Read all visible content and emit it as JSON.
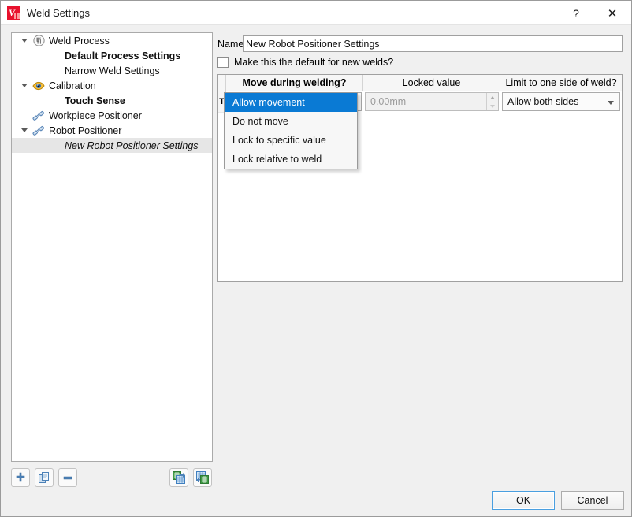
{
  "window": {
    "title": "Weld Settings",
    "app_icon": "weld-app-icon",
    "help_label": "?",
    "close_label": "✕"
  },
  "tree": {
    "items": [
      {
        "label": "Weld Process",
        "icon": "weld-process-icon",
        "indent": 0,
        "arrow": "expanded",
        "style": "normal",
        "selected": false
      },
      {
        "label": "Default Process Settings",
        "icon": "none",
        "indent": 1,
        "arrow": "none",
        "style": "bold",
        "selected": false
      },
      {
        "label": "Narrow Weld Settings",
        "icon": "none",
        "indent": 1,
        "arrow": "none",
        "style": "normal",
        "selected": false
      },
      {
        "label": "Calibration",
        "icon": "calibration-eye-icon",
        "indent": 0,
        "arrow": "expanded",
        "style": "normal",
        "selected": false
      },
      {
        "label": "Touch Sense",
        "icon": "none",
        "indent": 1,
        "arrow": "none",
        "style": "bold",
        "selected": false
      },
      {
        "label": "Workpiece Positioner",
        "icon": "positioner-icon",
        "indent": 0,
        "arrow": "none",
        "style": "normal",
        "selected": false
      },
      {
        "label": "Robot Positioner",
        "icon": "positioner-icon",
        "indent": 0,
        "arrow": "expanded",
        "style": "normal",
        "selected": false
      },
      {
        "label": "New Robot Positioner Settings",
        "icon": "none",
        "indent": 1,
        "arrow": "none",
        "style": "italic",
        "selected": true
      }
    ]
  },
  "form": {
    "name_label": "Name",
    "name_value": "New Robot Positioner Settings",
    "default_checkbox_label": "Make this the default for new welds?",
    "default_checkbox_checked": false
  },
  "table": {
    "headers": {
      "corner": "",
      "col1": "Move during welding?",
      "col2": "Locked value",
      "col3": "Limit to one side of weld?"
    },
    "rows": [
      {
        "row_header": "T",
        "move_during_welding": "Allow movement",
        "locked_value": "0.00mm",
        "locked_value_disabled": true,
        "limit_to_one_side": "Allow both sides"
      }
    ]
  },
  "dropdown": {
    "open": true,
    "selected_index": 0,
    "options": [
      "Allow movement",
      "Do not move",
      "Lock to specific value",
      "Lock relative to weld"
    ]
  },
  "toolbar": {
    "add_icon": "plus-icon",
    "copy_icon": "duplicate-icon",
    "remove_icon": "minus-icon",
    "import_icon": "import-spreadsheet-icon",
    "export_icon": "export-spreadsheet-icon"
  },
  "footer": {
    "ok_label": "OK",
    "cancel_label": "Cancel"
  },
  "colors": {
    "accent_selection": "#0a7ad4",
    "app_icon_red": "#e8112d",
    "dialog_bg": "#f0f0f0",
    "focus_border": "#4a9fe0"
  }
}
